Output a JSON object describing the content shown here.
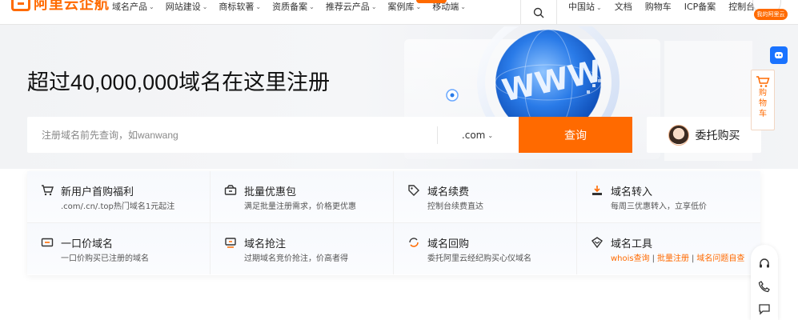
{
  "brand": {
    "name": "阿里云企航",
    "accent": "#ff6a00"
  },
  "nav": {
    "items": [
      {
        "label": "域名产品"
      },
      {
        "label": "网站建设"
      },
      {
        "label": "商标软著"
      },
      {
        "label": "资质备案"
      },
      {
        "label": "推荐云产品"
      },
      {
        "label": "案例库"
      },
      {
        "label": "移动端"
      }
    ],
    "right": [
      {
        "label": "中国站",
        "dropdown": true
      },
      {
        "label": "文档"
      },
      {
        "label": "购物车"
      },
      {
        "label": "ICP备案"
      },
      {
        "label": "控制台"
      }
    ],
    "avatar_tag": "我的阿里云",
    "search_icon": "search-icon"
  },
  "hero": {
    "title": "超过40,000,000域名在这里注册",
    "search": {
      "placeholder": "注册域名前先查询，如wanwang",
      "value": "",
      "tld": ".com",
      "button": "查询"
    },
    "broker_button": "委托购买"
  },
  "services": [
    [
      {
        "name": "新用户首购福利",
        "desc": ".com/.cn/.top热门域名1元起注",
        "icon": "cart-icon"
      },
      {
        "name": "批量优惠包",
        "desc": "满足批量注册需求，价格更优惠",
        "icon": "package-icon"
      },
      {
        "name": "域名续费",
        "desc": "控制台续费直达",
        "icon": "tag-icon"
      },
      {
        "name": "域名转入",
        "desc": "每周三优惠转入，立享低价",
        "icon": "transfer-icon"
      }
    ],
    [
      {
        "name": "一口价域名",
        "desc": "一口价购买已注册的域名",
        "icon": "ticket-icon"
      },
      {
        "name": "域名抢注",
        "desc": "过期域名竞价抢注，价高者得",
        "icon": "auction-icon"
      },
      {
        "name": "域名回购",
        "desc": "委托阿里云经纪购买心仪域名",
        "icon": "buyback-icon"
      },
      {
        "name": "域名工具",
        "icon": "tool-icon",
        "links": [
          "whois查询",
          "批量注册",
          "域名问题自查"
        ]
      }
    ]
  ],
  "float": {
    "cart_label": "购物车"
  }
}
